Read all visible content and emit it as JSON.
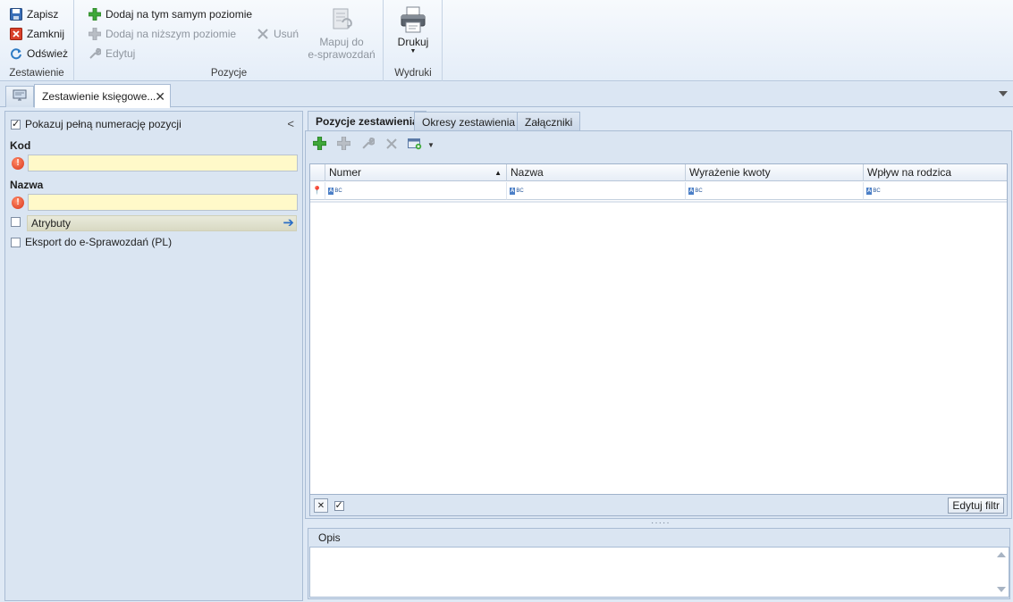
{
  "ribbon": {
    "groups": {
      "zestawienie": {
        "label": "Zestawienie",
        "save": "Zapisz",
        "close": "Zamknij",
        "refresh": "Odśwież"
      },
      "pozycje": {
        "label": "Pozycje",
        "add_same_level": "Dodaj na tym samym poziomie",
        "add_lower_level": "Dodaj na niższym poziomie",
        "edit": "Edytuj",
        "delete": "Usuń",
        "map_line1": "Mapuj do",
        "map_line2": "e-sprawozdań"
      },
      "wydruki": {
        "label": "Wydruki",
        "print": "Drukuj"
      }
    }
  },
  "tabs": {
    "document_tab": "Zestawienie księgowe..."
  },
  "left_panel": {
    "show_full_numbering": "Pokazuj pełną numerację pozycji",
    "show_full_numbering_checked": true,
    "kod_label": "Kod",
    "kod_value": "",
    "nazwa_label": "Nazwa",
    "nazwa_value": "",
    "atrybuty": "Atrybuty",
    "atrybuty_checked": false,
    "eksport": "Eksport do e-Sprawozdań (PL)",
    "eksport_checked": false
  },
  "inner_tabs": [
    "Pozycje zestawienia",
    "Okresy zestawienia",
    "Załączniki"
  ],
  "grid": {
    "columns": [
      "Numer",
      "Nazwa",
      "Wyrażenie kwoty",
      "Wpływ na rodzica"
    ],
    "sort_column": "Numer",
    "filter_row_icon": "abc-filter-icon",
    "rows": []
  },
  "grid_footer": {
    "edit_filter": "Edytuj filtr"
  },
  "opis": {
    "label": "Opis",
    "value": ""
  },
  "colors": {
    "required_field": "#fff9c9",
    "panel_bg": "#dae5f2",
    "accent_blue": "#2b6ec5",
    "add_green": "#3fa83a"
  }
}
